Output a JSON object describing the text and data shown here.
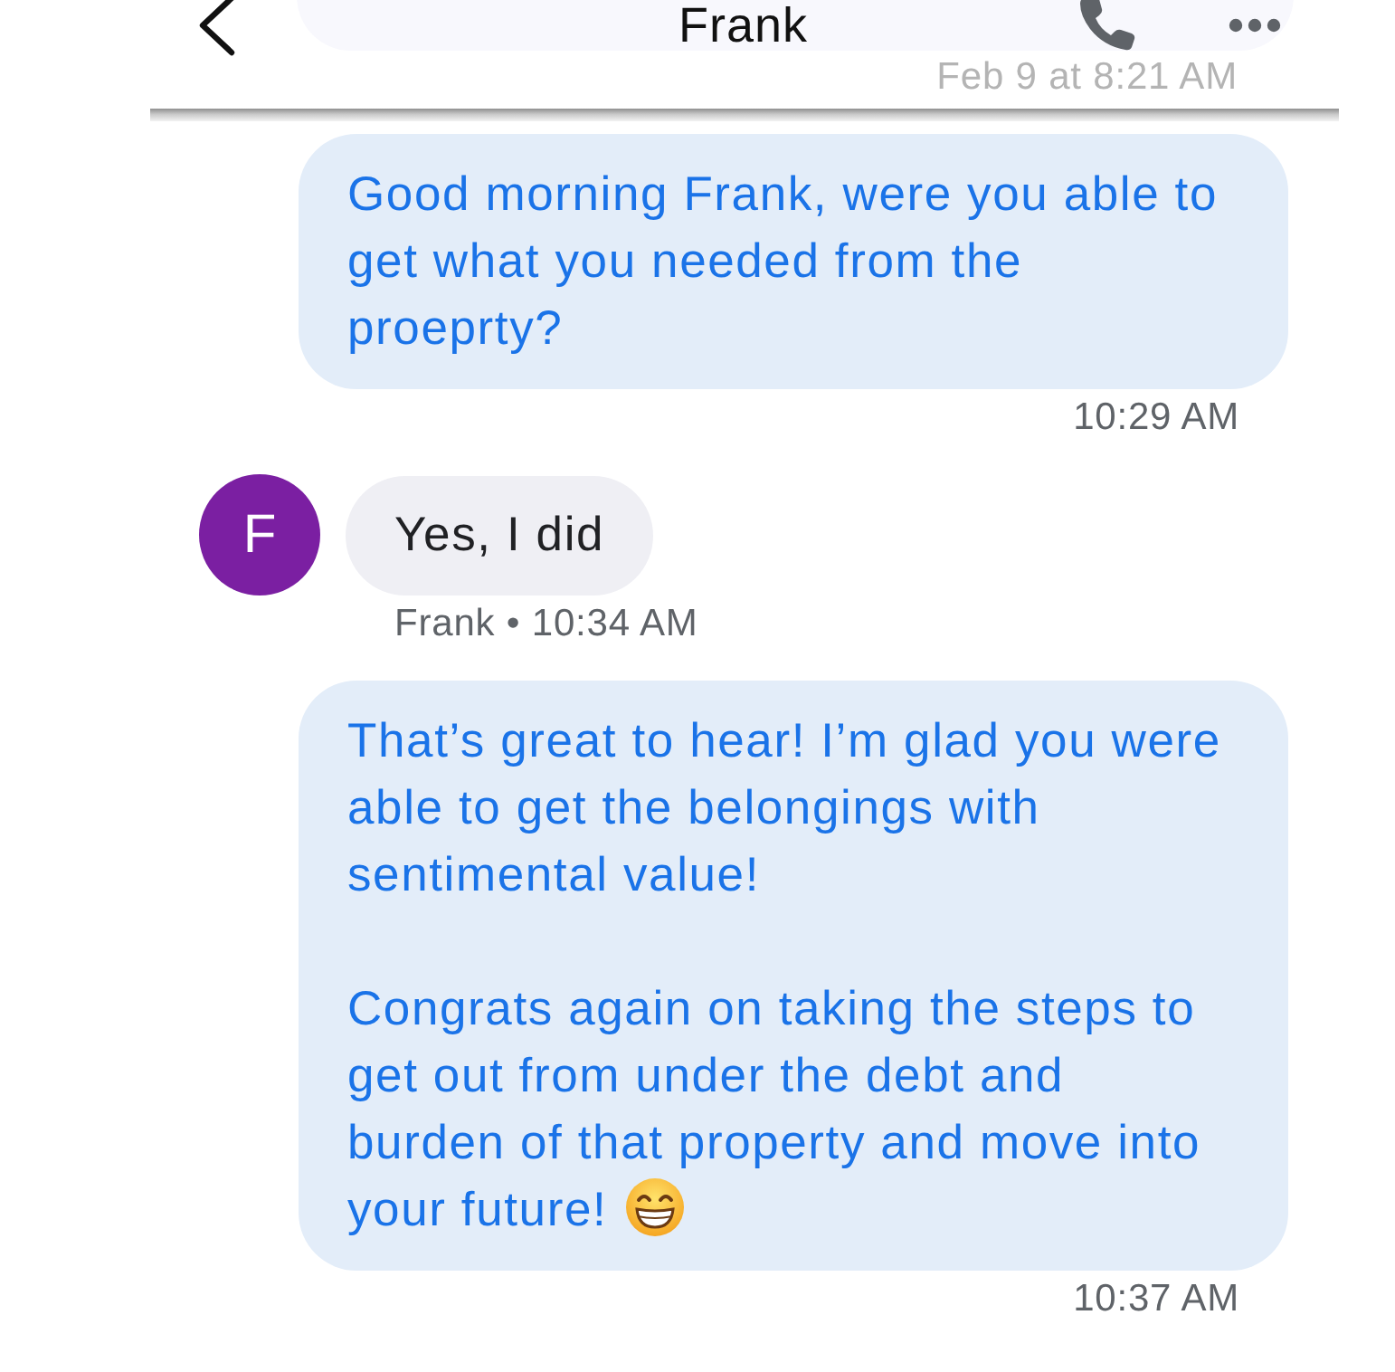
{
  "header": {
    "title": "Frank"
  },
  "previous": {
    "timestamp": "Feb 9 at 8:21 AM"
  },
  "messages": [
    {
      "kind": "outgoing",
      "paragraphs": [
        {
          "text": "Good morning Frank, were you able to get what you needed from the proeprty?",
          "emoji": false
        }
      ],
      "time": "10:29 AM"
    },
    {
      "kind": "incoming",
      "avatar": "F",
      "paragraphs": [
        {
          "text": "Yes, I did",
          "emoji": false
        }
      ],
      "time": "Frank • 10:34 AM"
    },
    {
      "kind": "outgoing",
      "paragraphs": [
        {
          "text": "That’s great to hear! I’m glad you were able to get the belongings with sentimental value!",
          "emoji": false
        },
        {
          "text": "Congrats again on taking the steps to get out from under the debt and burden of that property and move into your future!",
          "emoji": true
        }
      ],
      "time": "10:37 AM"
    }
  ]
}
